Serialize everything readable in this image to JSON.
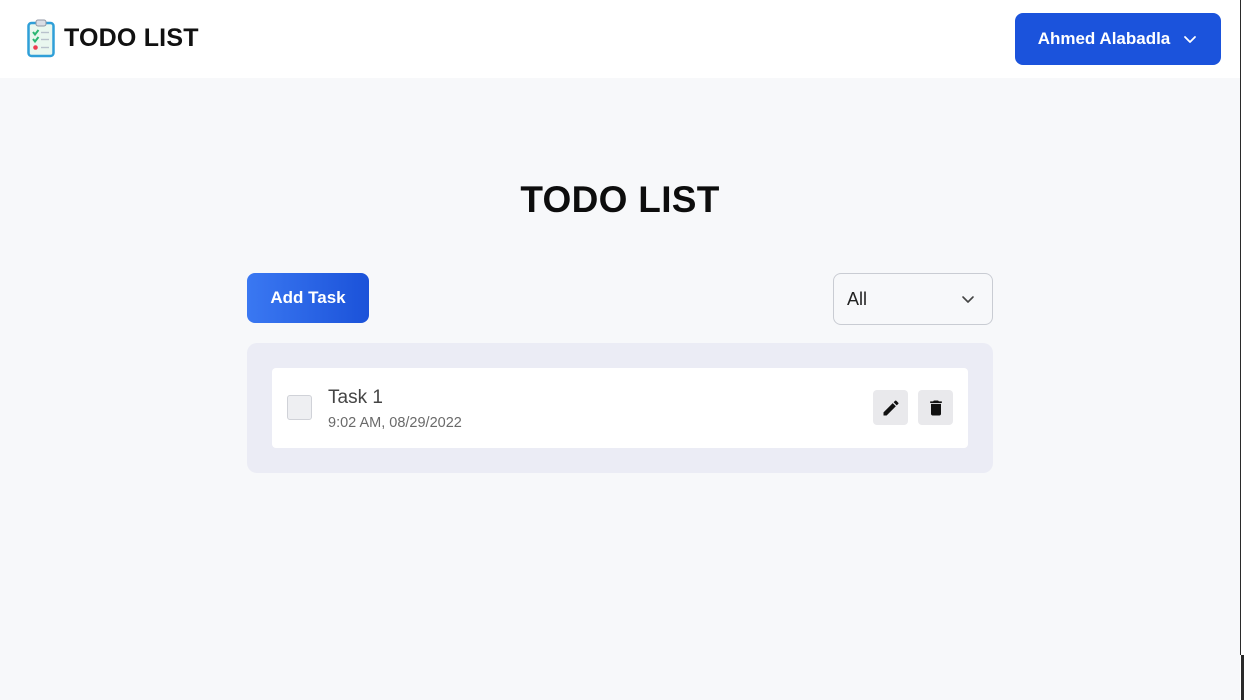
{
  "header": {
    "brand_title": "TODO LIST",
    "logo_icon": "clipboard-checklist-icon",
    "user_name": "Ahmed Alabadla",
    "user_menu_icon": "chevron-down-icon",
    "accent_color": "#1b53dc"
  },
  "main": {
    "title": "TODO LIST",
    "add_task_label": "Add Task",
    "filter": {
      "selected": "All",
      "icon": "chevron-down-icon"
    },
    "tasks": [
      {
        "title": "Task 1",
        "time": "9:02 AM, 08/29/2022",
        "completed": false,
        "edit_icon": "pencil-icon",
        "delete_icon": "trash-icon"
      }
    ]
  }
}
